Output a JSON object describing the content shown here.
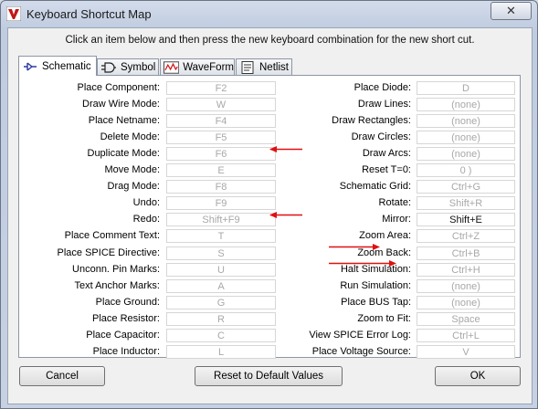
{
  "window": {
    "title": "Keyboard Shortcut Map"
  },
  "instruction": "Click an item below and then press the new keyboard combination for the new short cut.",
  "tabs": [
    {
      "label": "Schematic",
      "icon": "schematic-icon"
    },
    {
      "label": "Symbol",
      "icon": "symbol-icon"
    },
    {
      "label": "WaveForm",
      "icon": "waveform-icon"
    },
    {
      "label": "Netlist",
      "icon": "netlist-icon"
    }
  ],
  "left": [
    {
      "label": "Place Component:",
      "value": "F2"
    },
    {
      "label": "Draw Wire Mode:",
      "value": "W"
    },
    {
      "label": "Place Netname:",
      "value": "F4"
    },
    {
      "label": "Delete Mode:",
      "value": "F5"
    },
    {
      "label": "Duplicate Mode:",
      "value": "F6"
    },
    {
      "label": "Move Mode:",
      "value": "E"
    },
    {
      "label": "Drag Mode:",
      "value": "F8"
    },
    {
      "label": "Undo:",
      "value": "F9"
    },
    {
      "label": "Redo:",
      "value": "Shift+F9"
    },
    {
      "label": "Place Comment Text:",
      "value": "T"
    },
    {
      "label": "Place SPICE Directive:",
      "value": "S"
    },
    {
      "label": "Unconn. Pin Marks:",
      "value": "U"
    },
    {
      "label": "Text Anchor Marks:",
      "value": "A"
    },
    {
      "label": "Place Ground:",
      "value": "G"
    },
    {
      "label": "Place Resistor:",
      "value": "R"
    },
    {
      "label": "Place Capacitor:",
      "value": "C"
    },
    {
      "label": "Place Inductor:",
      "value": "L"
    }
  ],
  "right": [
    {
      "label": "Place Diode:",
      "value": "D"
    },
    {
      "label": "Draw Lines:",
      "value": "(none)"
    },
    {
      "label": "Draw Rectangles:",
      "value": "(none)"
    },
    {
      "label": "Draw Circles:",
      "value": "(none)"
    },
    {
      "label": "Draw Arcs:",
      "value": "(none)"
    },
    {
      "label": "Reset T=0:",
      "value": "0 )"
    },
    {
      "label": "Schematic Grid:",
      "value": "Ctrl+G"
    },
    {
      "label": "Rotate:",
      "value": "Shift+R"
    },
    {
      "label": "Mirror:",
      "value": "Shift+E"
    },
    {
      "label": "Zoom Area:",
      "value": "Ctrl+Z"
    },
    {
      "label": "Zoom Back:",
      "value": "Ctrl+B"
    },
    {
      "label": "Halt Simulation:",
      "value": "Ctrl+H"
    },
    {
      "label": "Run Simulation:",
      "value": "(none)"
    },
    {
      "label": "Place BUS Tap:",
      "value": "(none)"
    },
    {
      "label": "Zoom to Fit:",
      "value": "Space"
    },
    {
      "label": "View SPICE Error Log:",
      "value": "Ctrl+L"
    },
    {
      "label": "Place Voltage Source:",
      "value": "V"
    }
  ],
  "buttons": {
    "cancel": "Cancel",
    "reset": "Reset to Default Values",
    "ok": "OK"
  },
  "colors": {
    "arrow": "#e01010"
  }
}
